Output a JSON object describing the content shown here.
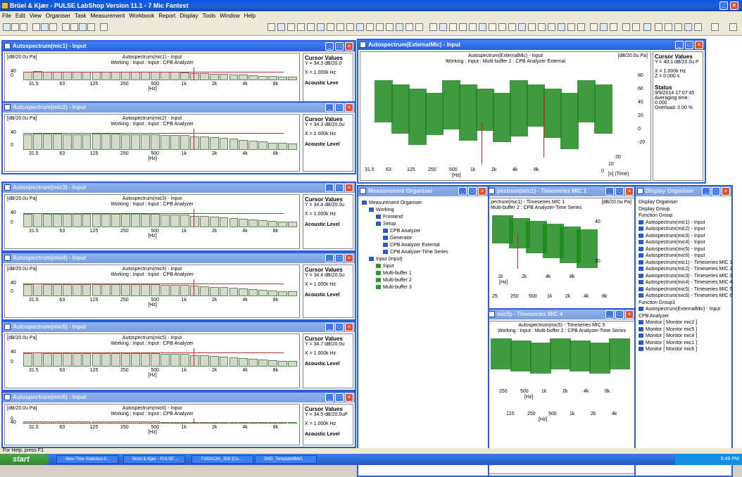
{
  "app": {
    "title": "Brüel & Kjær - PULSE LabShop Version 11.1 - 7 Mic Fantest"
  },
  "menu": [
    "File",
    "Edit",
    "View",
    "Organiser",
    "Task",
    "Measurement",
    "Workbook",
    "Report",
    "Display",
    "Tools",
    "Window",
    "Help"
  ],
  "spectra": [
    {
      "title": "Autospectrum(mic1) - Input",
      "hdr1": "Autospectrum(mic1) - Input",
      "hdr2": "Working : Input : Input : CPB Analyzer",
      "cv": "Y = 34.3 dB/20.0",
      "x": "X = 1.000k Hz",
      "extra": "Acoustic Leve"
    },
    {
      "title": "Autospectrum(mic2) - Input",
      "hdr1": "Autospectrum(mic2) - Input",
      "hdr2": "Working : Input : Input : CPB Analyzer",
      "cv": "Y = 34.3 dB/20.0u",
      "x": "X = 1.000k Hz",
      "extra": "Acoustic Level"
    },
    {
      "title": "Autospectrum(mic3) - Input",
      "hdr1": "Autospectrum(mic3) - Input",
      "hdr2": "Working : Input : Input : CPB Analyzer",
      "cv": "Y = 34.4 dB/20.0u",
      "x": "X = 1.000k Hz",
      "extra": "Acoustic Level"
    },
    {
      "title": "Autospectrum(mic4) - Input",
      "hdr1": "Autospectrum(mic4) - Input",
      "hdr2": "Working : Input : Input : CPB Analyzer",
      "cv": "Y = 34.4 dB/20.0u",
      "x": "X = 1.000k Hz",
      "extra": "Acoustic Level"
    },
    {
      "title": "Autospectrum(mic5) - Input",
      "hdr1": "Autospectrum(mic5) - Input",
      "hdr2": "Working : Input : Input : CPB Analyzer",
      "cv": "Y = 34.7 dB/20.0u",
      "x": "X = 1.000k Hz",
      "extra": "Acoustic Level"
    },
    {
      "title": "Autospectrum(mic6) - Input",
      "hdr1": "Autospectrum(mic6) - Input",
      "hdr2": "Working : Input : Input : CPB Analyzer",
      "cv": "Y = 34.5 dB/20.0uP",
      "x": "X = 1.000k Hz",
      "extra": "Acoustic Level"
    }
  ],
  "unit": "[dB/20.0u Pa]",
  "cursor_title": "Cursor Values",
  "xticks": [
    "31.5",
    "63",
    "125",
    "250",
    "500",
    "1k",
    "2k",
    "4k",
    "8k"
  ],
  "xunit": "[Hz]",
  "yticks": [
    "40",
    "0"
  ],
  "external": {
    "title": "Autospectrum(ExternalMic) - Input",
    "hdr1": "Autospectrum(ExternalMic) - Input",
    "hdr2": "Working : Input : Multi-buffer 1 : CPB Analyzer External",
    "unit": "[dB/20.0u Pa]",
    "cv": "Y = 40.1 dB/20.0u P",
    "x": "X = 1.000k Hz",
    "z": "Z = 0.000 s",
    "status": "Status",
    "date": "9/9/2014 17:07:45",
    "avg": "Averaging time: 0.000",
    "ovl": "Overload: 0.00 %",
    "zticks": [
      "80",
      "60",
      "40",
      "20",
      "0",
      "-20"
    ],
    "tticks": [
      "20",
      "10",
      "0"
    ],
    "tunit": "[s] (Time)"
  },
  "organiser": {
    "title": "Measurement Organiser",
    "items": [
      "Measurement Organiser",
      "Working",
      "Frontend",
      "Setup",
      "CPB Analyzer",
      "Generator",
      "CPB Analyzer External",
      "CPB Analyzer-Time Series",
      "Input (Input)",
      "Input",
      "Multi-buffer 1",
      "Multi-buffer 2",
      "Multi-buffer 3"
    ]
  },
  "ts1": {
    "title": "pectrum(mic1) - Timeseries MIC 1",
    "hdr1": "pectrum(mic1) - Timeseries MIC 1",
    "hdr2": "Multi-buffer 2 : CPB Analyzer-Time Series",
    "unit": "[dB/20.0u Pa]"
  },
  "ts5": {
    "title": "mic5) - Timeseries MIC 4",
    "hdr1": "Autospectrum(mic5) - Timeseries MIC 5",
    "hdr2": "Working : Input : Multi-buffer 2 : CPB Analyzer-Time Series"
  },
  "display": {
    "title": "Display Organiser",
    "items": [
      "Display Organiser",
      "Display Group",
      "Function Group",
      "Autospectrum(mic1) - Input",
      "Autospectrum(mic2) - Input",
      "Autospectrum(mic3) - Input",
      "Autospectrum(mic4) - Input",
      "Autospectrum(mic5) - Input",
      "Autospectrum(mic6) - Input",
      "Autospectrum(mic1) - Timeseries MIC 1",
      "Autospectrum(mic2) - Timeseries MIC 2",
      "Autospectrum(mic3) - Timeseries MIC 3",
      "Autospectrum(mic4) - Timeseries MIC 4",
      "Autospectrum(mic5) - Timeseries MIC 5",
      "Autospectrum(mic6) - Timeseries MIC 6",
      "Function Group1",
      "Autospectrum(ExternalMic) - Input",
      "CPB Analyzer",
      "Monitor [ Monitor mic2 ]",
      "Monitor [ Monitor mic5 ]",
      "Monitor [ Monitor mic4 ]",
      "Monitor [ Monitor mic1 ]",
      "Monitor [ Monitor mic6 ]"
    ]
  },
  "statusbar": "For Help, press F1",
  "taskbar": {
    "start": "start",
    "tasks": [
      "New-Time Statistics-0...",
      "Brüel & Kjær - PULSE ...",
      "7150A12A_JDK [Co...",
      "SND_Template9M#1"
    ],
    "time": "5:49 PM"
  }
}
